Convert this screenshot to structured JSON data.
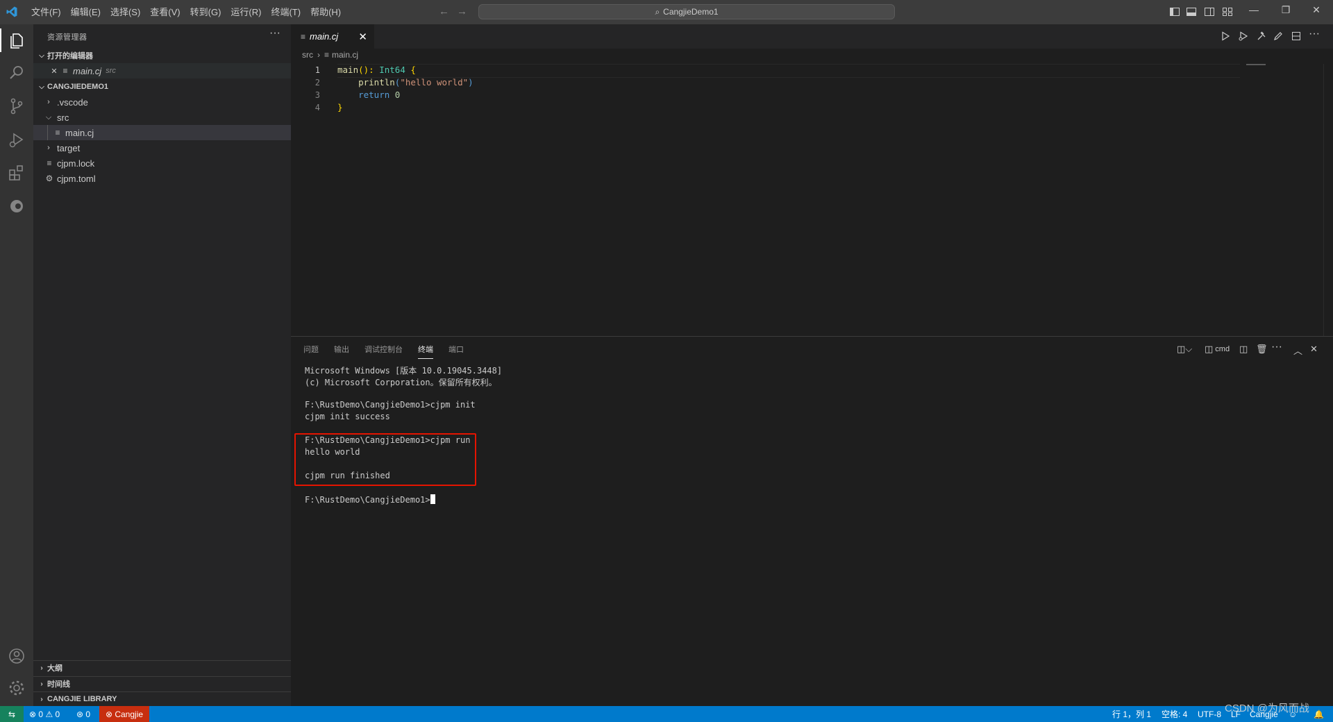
{
  "titlebar": {
    "menu": [
      "文件(F)",
      "编辑(E)",
      "选择(S)",
      "查看(V)",
      "转到(G)",
      "运行(R)",
      "终端(T)",
      "帮助(H)"
    ],
    "command_center": "CangjieDemo1",
    "back_icon": "arrow-left-icon",
    "forward_icon": "arrow-right-icon",
    "window_controls": {
      "minimize": "—",
      "restore": "❐",
      "close": "✕"
    }
  },
  "sidebar": {
    "title": "资源管理器",
    "more": "···",
    "open_editors": {
      "header": "打开的编辑器",
      "items": [
        {
          "name": "main.cj",
          "desc": "src"
        }
      ]
    },
    "workspace": {
      "header": "CANGJIEDEMO1",
      "items": [
        {
          "name": ".vscode",
          "type": "folder",
          "expanded": false
        },
        {
          "name": "src",
          "type": "folder",
          "expanded": true
        },
        {
          "name": "main.cj",
          "type": "file"
        },
        {
          "name": "target",
          "type": "folder",
          "expanded": false
        },
        {
          "name": "cjpm.lock",
          "type": "file"
        },
        {
          "name": "cjpm.toml",
          "type": "file"
        }
      ]
    },
    "bottom_sections": [
      "大纲",
      "时间线",
      "CANGJIE LIBRARY"
    ]
  },
  "editor": {
    "tab": {
      "label": "main.cj",
      "close": "✕"
    },
    "breadcrumb": [
      "src",
      "main.cj"
    ],
    "line_numbers": [
      "1",
      "2",
      "3",
      "4"
    ],
    "code": {
      "l1": {
        "fn": "main",
        "paren": "(): ",
        "type": "Int64",
        "brace": " {"
      },
      "l2": {
        "indent": "    ",
        "fn": "println",
        "open": "(",
        "str": "\"hello world\"",
        "close": ")"
      },
      "l3": {
        "indent": "    ",
        "kw": "return",
        "sp": " ",
        "num": "0"
      },
      "l4": {
        "brace": "}"
      }
    }
  },
  "panel": {
    "tabs": [
      "问题",
      "输出",
      "调试控制台",
      "终端",
      "端口"
    ],
    "active_tab": "终端",
    "shell_label": "cmd",
    "terminal_lines": [
      "Microsoft Windows [版本 10.0.19045.3448]",
      "(c) Microsoft Corporation。保留所有权利。",
      "",
      "F:\\RustDemo\\CangjieDemo1>cjpm init",
      "cjpm init success",
      "",
      "F:\\RustDemo\\CangjieDemo1>cjpm run",
      "hello world",
      "",
      "cjpm run finished",
      "",
      "F:\\RustDemo\\CangjieDemo1>"
    ]
  },
  "statusbar": {
    "errors": "0",
    "warnings": "0",
    "ports": "0",
    "language_server": "Cangjie",
    "position": "行 1，列 1",
    "spaces": "空格: 4",
    "encoding": "UTF-8",
    "eol": "LF",
    "language": "Cangjie"
  },
  "watermark": "CSDN @为风而战",
  "colors": {
    "accent": "#007acc",
    "highlight_box": "#e51400",
    "error_badge": "#c72e0f"
  }
}
